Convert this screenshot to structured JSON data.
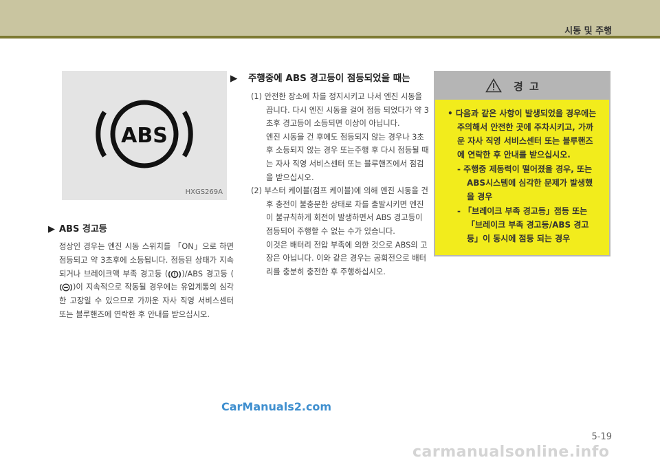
{
  "header": {
    "title": "시동 및 주행"
  },
  "figure": {
    "label": "HXGS269A",
    "icon": "abs-warning-light-icon",
    "icon_text": "ABS"
  },
  "section1": {
    "heading": "ABS 경고등",
    "line1": "정상인 경우는 엔진 시동 스위치를 「ON」으로 하면 점등되고 약 3초후에 소등됩니다. 점등된 상태가 지속되거나 브레이크액 부족 경고등",
    "line2": "(",
    "line3": ")/ABS 경고등 (",
    "line4": ")이 지속적으로 작동될 경우에는 유압계통의 심각한 고장일 수 있으므로 가까운 자사 직영 서비스센터 또는 블루핸즈에 연락한 후 안내를 받으십시오."
  },
  "section2": {
    "heading": "주행중에 ABS 경고등이 점등되었을 때는",
    "items": [
      {
        "num": "(1)",
        "p1": "안전한 장소에 차를 정지시키고 나서 엔진 시동을 끕니다. 다시 엔진 시동을 걸어 점등 되었다가 약 3초후 경고등이 소등되면 이상이 아닙니다.",
        "p2": "엔진 시동을 건 후에도 점등되지 않는 경우나 3초후 소등되지 않는 경우 또는주행 후 다시 점등될 때는 자사 직영 서비스센터 또는 블루핸즈에서 점검을 받으십시오."
      },
      {
        "num": "(2)",
        "p1": "부스터 케이블(점프 케이블)에 의해 엔진 시동을 건 후 충전이 불충분한 상태로 차를 출발시키면 엔진이 불규칙하게 회전이 발생하면서 ABS 경고등이 점등되어 주행할 수 없는 수가 있습니다.",
        "p2": "이것은 배터리 전압 부족에 의한 것으로 ABS의 고장은 아닙니다. 이와 같은 경우는 공회전으로 배터리를 충분히 충전한 후 주행하십시오."
      }
    ]
  },
  "warning": {
    "title": "경 고",
    "bullet": "다음과 같은 사항이 발생되었을 경우에는 주의해서 안전한 곳에 주차시키고, 가까운 자사 직영 서비스센터 또는 블루핸즈에 연락한 후 안내를 받으십시오.",
    "dashes": [
      "주행중 제동력이 떨어졌을 경우, 또는 ABS시스템에 심각한 문제가 발생했을 경우",
      "「브레이크 부족 경고등」점등 또는 「브레이크 부족 경고등/ABS 경고등」이 동시에 점등 되는 경우"
    ]
  },
  "footer": {
    "watermark": "CarManuals2.com",
    "page": "5-19",
    "site": "carmanualsonline.info"
  },
  "colors": {
    "header_band": "#c9c5a0",
    "header_rule": "#7d7a32",
    "warning_bg": "#f2ec1c",
    "warning_head": "#b5b5b5",
    "watermark": "#3f8fcf"
  }
}
